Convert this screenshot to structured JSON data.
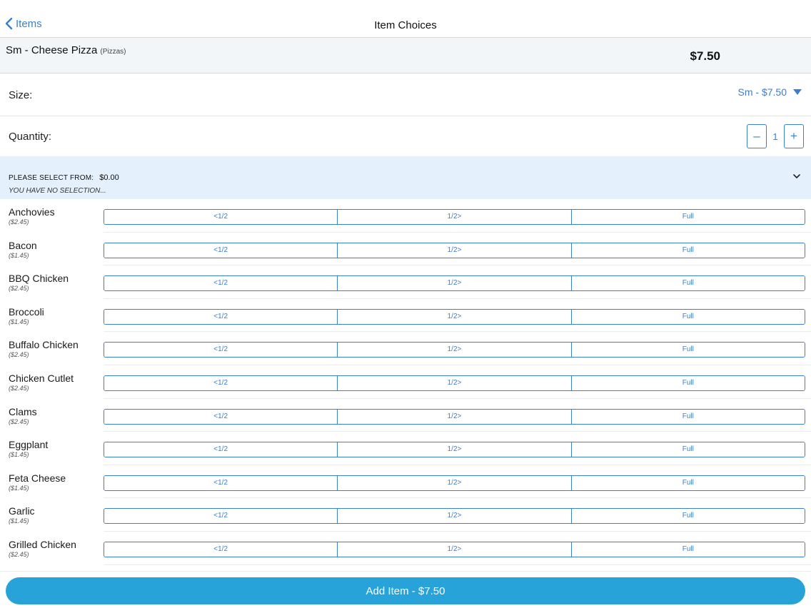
{
  "nav": {
    "back_label": "Items",
    "title": "Item Choices"
  },
  "item": {
    "name": "Sm - Cheese Pizza",
    "category": "(Pizzas)",
    "price": "$7.50"
  },
  "size": {
    "label": "Size:",
    "selected": "Sm - $7.50"
  },
  "quantity": {
    "label": "Quantity:",
    "value": "1",
    "minus": "–",
    "plus": "+"
  },
  "section": {
    "title": "PLEASE SELECT FROM:",
    "amount": "$0.00",
    "subtitle": "YOU HAVE NO SELECTION..."
  },
  "portion_options": [
    "<1/2",
    "1/2>",
    "Full"
  ],
  "toppings": [
    {
      "name": "Anchovies",
      "price": "($2.45)"
    },
    {
      "name": "Bacon",
      "price": "($1.45)"
    },
    {
      "name": "BBQ Chicken",
      "price": "($2.45)"
    },
    {
      "name": "Broccoli",
      "price": "($1.45)"
    },
    {
      "name": "Buffalo Chicken",
      "price": "($2.45)"
    },
    {
      "name": "Chicken Cutlet",
      "price": "($2.45)"
    },
    {
      "name": "Clams",
      "price": "($2.45)"
    },
    {
      "name": "Eggplant",
      "price": "($1.45)"
    },
    {
      "name": "Feta Cheese",
      "price": "($1.45)"
    },
    {
      "name": "Garlic",
      "price": "($1.45)"
    },
    {
      "name": "Grilled Chicken",
      "price": "($2.45)"
    }
  ],
  "footer": {
    "add_label": "Add Item - $7.50"
  },
  "colors": {
    "accent": "#3b7fcf",
    "button": "#27a3d9",
    "section_bg": "#e4f0fb",
    "header_bg": "#f3f6f9"
  },
  "icons": {
    "back": "chevron-left-icon",
    "dropdown": "triangle-down-icon",
    "section_toggle": "chevron-down-icon"
  }
}
